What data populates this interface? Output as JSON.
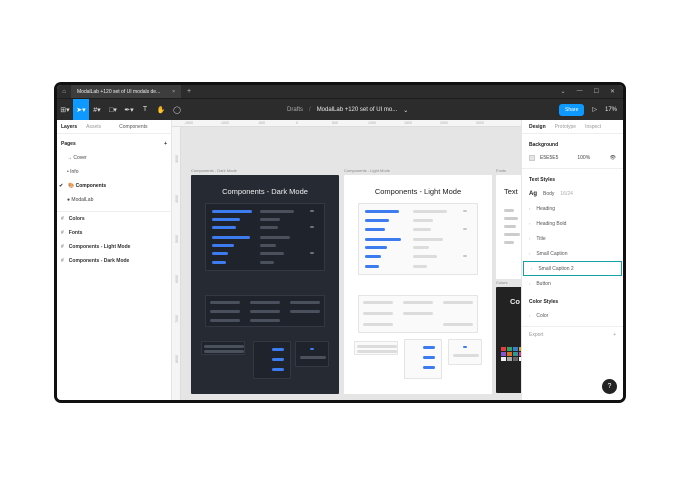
{
  "window": {
    "tab_title": "ModalLab +120 set of UI modals de...",
    "home_icon": "home-icon",
    "close_glyph": "×",
    "new_tab_glyph": "+",
    "controls": [
      "⌄",
      "—",
      "☐",
      "✕"
    ]
  },
  "toolbar": {
    "tools": [
      {
        "name": "main-menu-icon",
        "glyph": "⊞▾"
      },
      {
        "name": "move-tool-icon",
        "glyph": "➤▾",
        "active": true
      },
      {
        "name": "frame-tool-icon",
        "glyph": "#▾"
      },
      {
        "name": "shape-tool-icon",
        "glyph": "□▾"
      },
      {
        "name": "pen-tool-icon",
        "glyph": "✒▾"
      },
      {
        "name": "text-tool-icon",
        "glyph": "T"
      },
      {
        "name": "hand-tool-icon",
        "glyph": "✋"
      },
      {
        "name": "comment-tool-icon",
        "glyph": "◯"
      }
    ],
    "breadcrumb_root": "Drafts",
    "breadcrumb_sep": "/",
    "file_title": "ModalLab +120 set of UI mo...",
    "file_chevron": "⌄",
    "share_label": "Share",
    "play_glyph": "▷",
    "zoom": "17%"
  },
  "left_panel": {
    "tabs": [
      "Layers",
      "Assets"
    ],
    "components_label": "Components",
    "pages_title": "Pages",
    "add_glyph": "+",
    "pages": [
      {
        "label": "→ Cover"
      },
      {
        "label": "• Info"
      },
      {
        "label": "🎨 Components",
        "selected": true
      },
      {
        "label": "● ModalLab"
      }
    ],
    "layers": [
      "Colors",
      "Fonts",
      "Components - Light Mode",
      "Components - Dark Mode"
    ]
  },
  "canvas": {
    "ruler_top": [
      "-1500",
      "-1000",
      "-500",
      "0",
      "500",
      "1000",
      "1500",
      "2000",
      "3000",
      "3500",
      "4000"
    ],
    "ruler_left": [
      "3000",
      "4000",
      "5000",
      "6000",
      "7000",
      "8000",
      "9000"
    ],
    "frames": [
      {
        "label": "Components - Dark Mode",
        "title": "Components - Dark Mode"
      },
      {
        "label": "Components - Light Mode",
        "title": "Components - Light Mode"
      },
      {
        "label": "Fonts",
        "title": "Text"
      },
      {
        "label": "Colors",
        "title": "Co"
      }
    ]
  },
  "right_panel": {
    "tabs": [
      "Design",
      "Prototype",
      "Inspect"
    ],
    "background_title": "Background",
    "bg_hex": "E5E5E5",
    "bg_pct": "100%",
    "eye_glyph": "👁",
    "text_styles_title": "Text Styles",
    "ag_glyph": "Ag",
    "body_label": "Body",
    "body_meta": "16/24",
    "text_styles": [
      "Heading",
      "Heading Bold",
      "Title",
      "Small Caption",
      "Small Caption 2",
      "Button"
    ],
    "color_styles_title": "Color Styles",
    "color_styles": [
      "Color"
    ],
    "export_label": "Export",
    "help_glyph": "?"
  },
  "colors": {
    "accent": "#0d99ff",
    "dark_board": "#262a33",
    "highlight": "#18a0a8"
  }
}
